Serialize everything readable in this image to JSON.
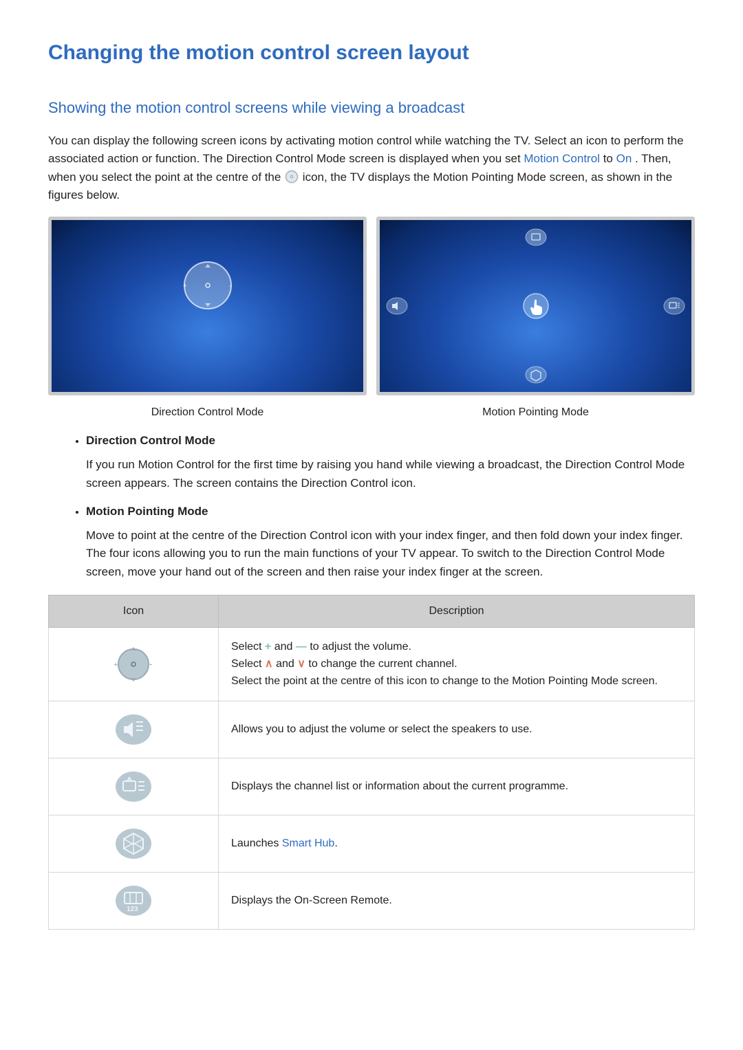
{
  "title": "Changing the motion control screen layout",
  "subtitle": "Showing the motion control screens while viewing a broadcast",
  "intro": {
    "part1": "You can display the following screen icons by activating motion control while watching the TV. Select an icon to perform the associated action or function. The Direction Control Mode screen is displayed when you set ",
    "mc": "Motion Control",
    "to": " to ",
    "on": "On",
    "part2": ". Then, when you select the point at the centre of the ",
    "part3": " icon, the TV displays the Motion Pointing Mode screen, as shown in the figures below."
  },
  "captions": {
    "left": "Direction Control Mode",
    "right": "Motion Pointing Mode"
  },
  "modes": [
    {
      "name": "Direction Control Mode",
      "desc": "If you run Motion Control for the first time by raising you hand while viewing a broadcast, the Direction Control Mode screen appears. The screen contains the Direction Control icon."
    },
    {
      "name": "Motion Pointing Mode",
      "desc": "Move to point at the centre of the Direction Control icon with your index finger, and then fold down your index finger. The four icons allowing you to run the main functions of your TV appear. To switch to the Direction Control Mode screen, move your hand out of the screen and then raise your index finger at the screen."
    }
  ],
  "table": {
    "headers": {
      "icon": "Icon",
      "desc": "Description"
    },
    "rows": [
      {
        "icon_name": "direction-control-icon",
        "desc": {
          "l1a": "Select ",
          "plus": "+",
          "l1b": " and ",
          "minus": "—",
          "l1c": " to adjust the volume.",
          "l2a": "Select ",
          "up": "∧",
          "l2b": " and ",
          "down": "∨",
          "l2c": " to change the current channel.",
          "l3": "Select the point at the centre of this icon to change to the Motion Pointing Mode screen."
        }
      },
      {
        "icon_name": "volume-speaker-icon",
        "desc_plain": "Allows you to adjust the volume or select the speakers to use."
      },
      {
        "icon_name": "channel-list-icon",
        "desc_plain": "Displays the channel list or information about the current programme."
      },
      {
        "icon_name": "smart-hub-icon",
        "desc_launches": "Launches ",
        "smart_hub": "Smart Hub",
        "period": "."
      },
      {
        "icon_name": "on-screen-remote-icon",
        "desc_plain": "Displays the On-Screen Remote."
      }
    ]
  }
}
